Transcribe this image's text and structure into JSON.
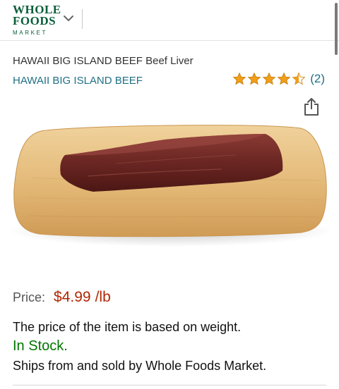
{
  "header": {
    "logo": {
      "line1": "WHOLE",
      "line2": "FOODS",
      "line3": "MARKET"
    },
    "icons": {
      "menu": "chevron-down-icon"
    }
  },
  "product": {
    "title": "HAWAII BIG ISLAND BEEF Beef Liver",
    "brand": "HAWAII BIG ISLAND BEEF",
    "rating": {
      "stars": 4.5,
      "max_stars": 5,
      "count_label": "(2)"
    },
    "share_icon": "share-icon",
    "image_subject": "beef-liver-on-cutting-board"
  },
  "price": {
    "label": "Price:",
    "value": "$4.99",
    "unit": "/lb"
  },
  "details": {
    "weight_note": "The price of the item is based on weight.",
    "stock": "In Stock.",
    "ships": "Ships from and sold by Whole Foods Market."
  },
  "colors": {
    "logo_green": "#0b5e3a",
    "link_teal": "#1f7085",
    "star_orange": "#f19e1a",
    "price_red": "#b12704",
    "stock_green": "#007600"
  }
}
